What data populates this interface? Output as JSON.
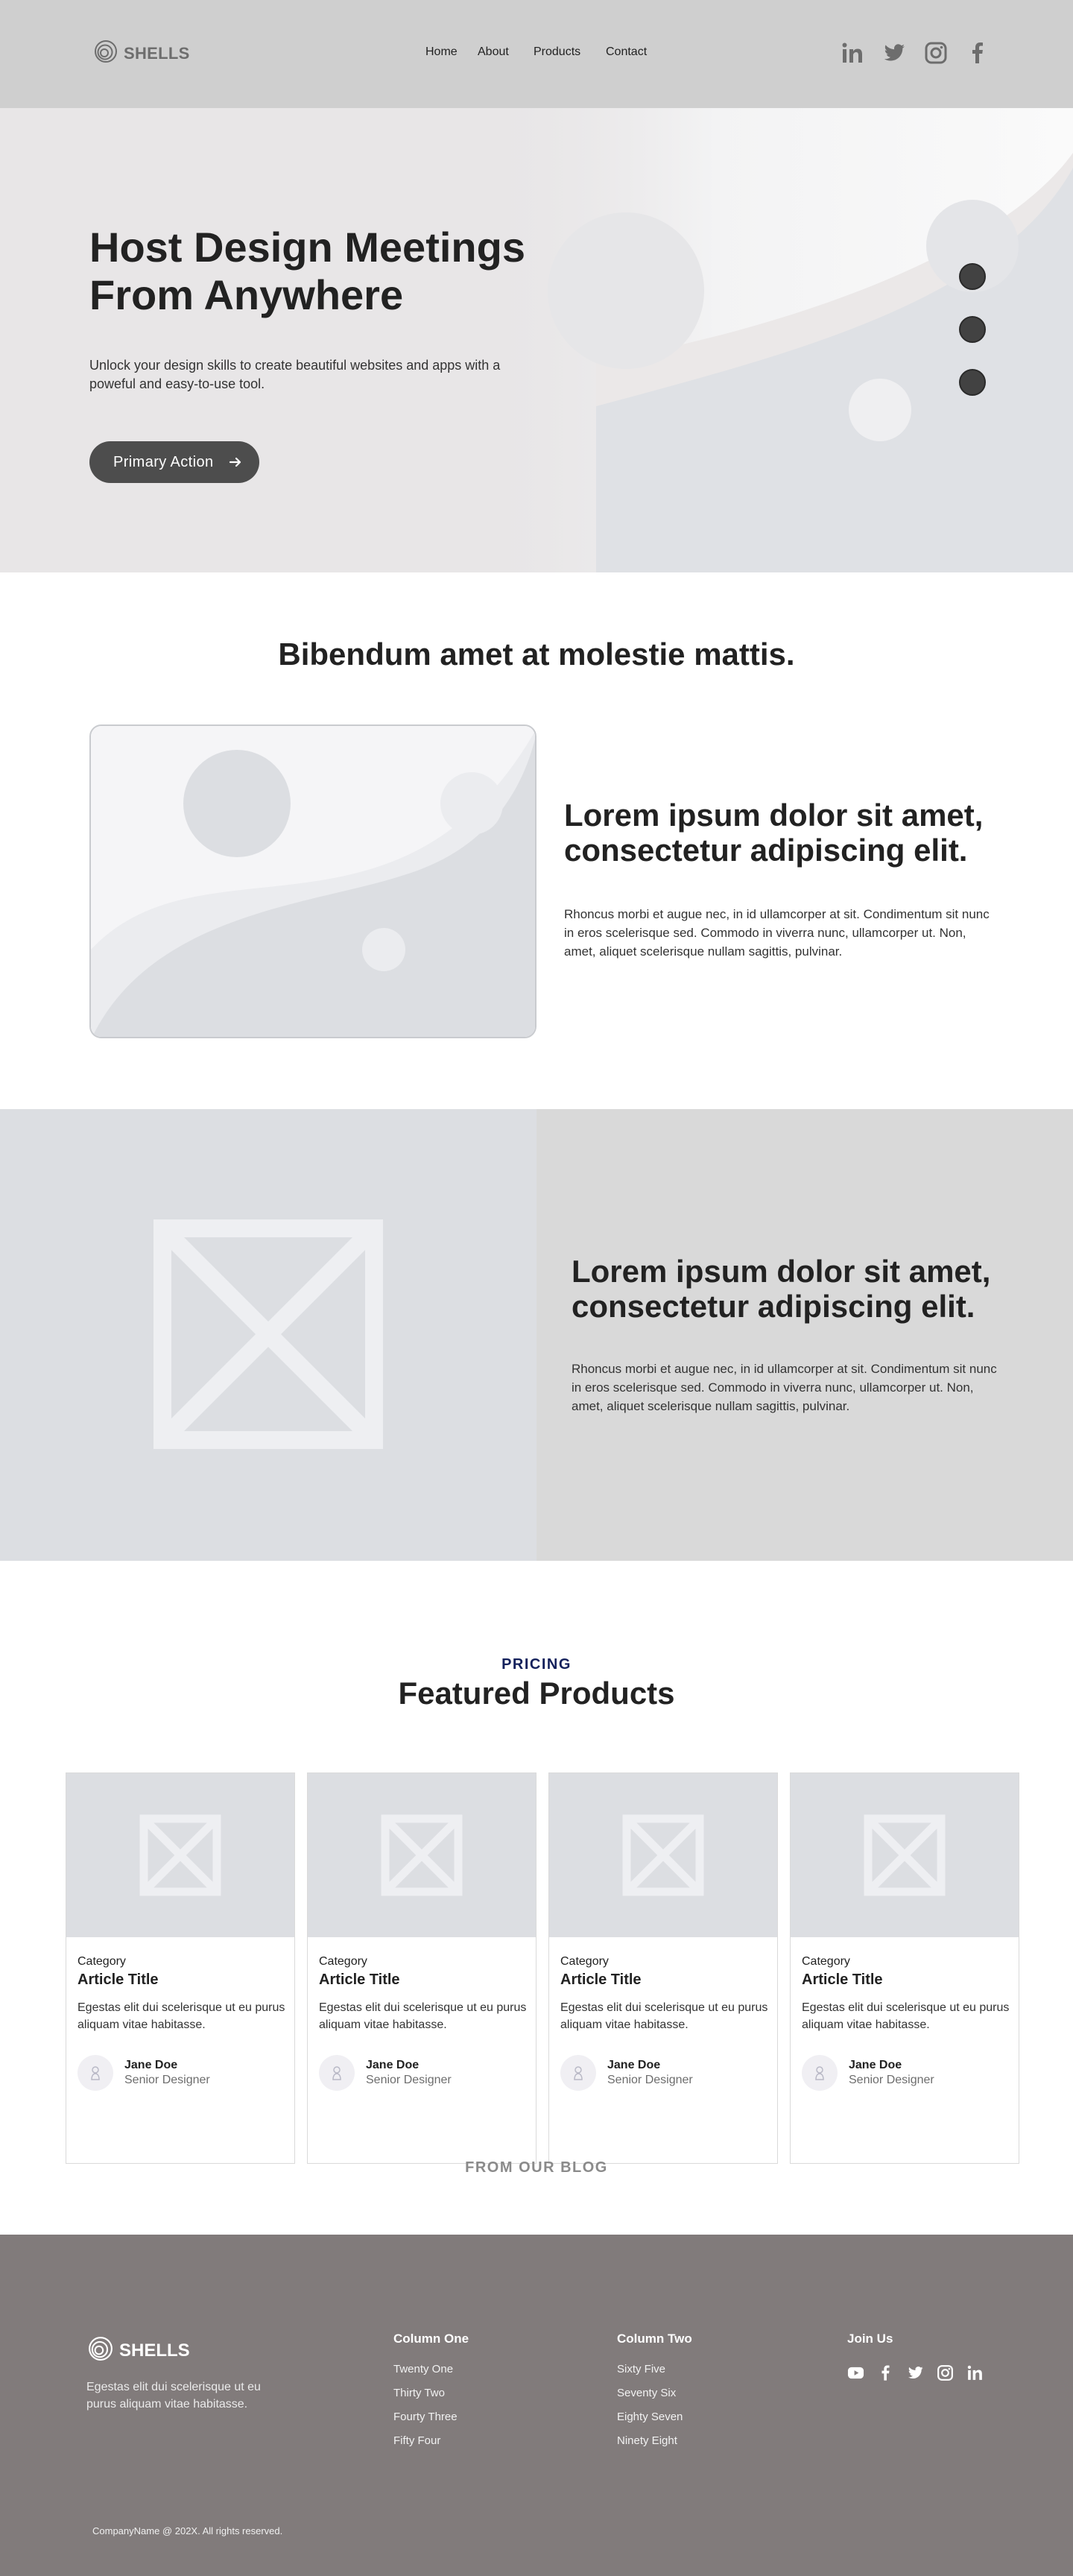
{
  "brand": {
    "name": "SHELLS",
    "logo_icon": "concentric-circles-icon"
  },
  "nav": {
    "items": [
      {
        "label": "Home"
      },
      {
        "label": "About"
      },
      {
        "label": "Products"
      },
      {
        "label": "Contact"
      }
    ],
    "social": [
      "linkedin-icon",
      "twitter-icon",
      "instagram-icon",
      "facebook-icon"
    ]
  },
  "hero": {
    "title": "Host Design Meetings From Anywhere",
    "subtitle": "Unlock your design skills to create beautiful websites and apps with a poweful and easy-to-use tool.",
    "cta_label": "Primary Action",
    "slider_dots": 3
  },
  "feature": {
    "section_title": "Bibendum amet at molestie mattis.",
    "heading": "Lorem ipsum dolor sit amet, consectetur adipiscing elit.",
    "body": "Rhoncus morbi et augue nec, in id ullamcorper at sit. Condimentum sit nunc in eros scelerisque sed. Commodo in viverra nunc, ullamcorper ut. Non, amet, aliquet scelerisque nullam sagittis, pulvinar."
  },
  "split": {
    "heading": "Lorem ipsum dolor sit amet, consectetur adipiscing elit.",
    "body": "Rhoncus morbi et augue nec, in id ullamcorper at sit. Condimentum sit nunc in eros scelerisque sed. Commodo in viverra nunc, ullamcorper ut. Non, amet, aliquet scelerisque nullam sagittis, pulvinar."
  },
  "pricing": {
    "eyebrow": "PRICING",
    "title": "Featured Products",
    "cards": [
      {
        "category": "Category",
        "title": "Article Title",
        "description": "Egestas elit dui scelerisque ut eu purus aliquam vitae habitasse.",
        "author": "Jane Doe",
        "role": "Senior Designer"
      },
      {
        "category": "Category",
        "title": "Article Title",
        "description": "Egestas elit dui scelerisque ut eu purus aliquam vitae habitasse.",
        "author": "Jane Doe",
        "role": "Senior Designer"
      },
      {
        "category": "Category",
        "title": "Article Title",
        "description": "Egestas elit dui scelerisque ut eu purus aliquam vitae habitasse.",
        "author": "Jane Doe",
        "role": "Senior Designer"
      },
      {
        "category": "Category",
        "title": "Article Title",
        "description": "Egestas elit dui scelerisque ut eu purus aliquam vitae habitasse.",
        "author": "Jane Doe",
        "role": "Senior Designer"
      }
    ],
    "blog_label": "FROM OUR BLOG"
  },
  "footer": {
    "brand_name": "SHELLS",
    "tagline": "Egestas elit dui scelerisque ut eu purus aliquam vitae habitasse.",
    "columns": [
      {
        "title": "Column One",
        "links": [
          "Twenty One",
          "Thirty Two",
          "Fourty Three",
          "Fifty Four"
        ]
      },
      {
        "title": "Column Two",
        "links": [
          "Sixty Five",
          "Seventy Six",
          "Eighty Seven",
          "Ninety Eight"
        ]
      }
    ],
    "join_title": "Join Us",
    "social": [
      "youtube-icon",
      "facebook-icon",
      "twitter-icon",
      "instagram-icon",
      "linkedin-icon"
    ],
    "copyright": "CompanyName @ 202X. All rights reserved."
  },
  "colors": {
    "nav_bg": "#cfcfcf",
    "hero_bg": "#e8e6e7",
    "primary_button": "#4d4d4d",
    "eyebrow": "#14215c",
    "footer_bg": "#817b7b"
  }
}
